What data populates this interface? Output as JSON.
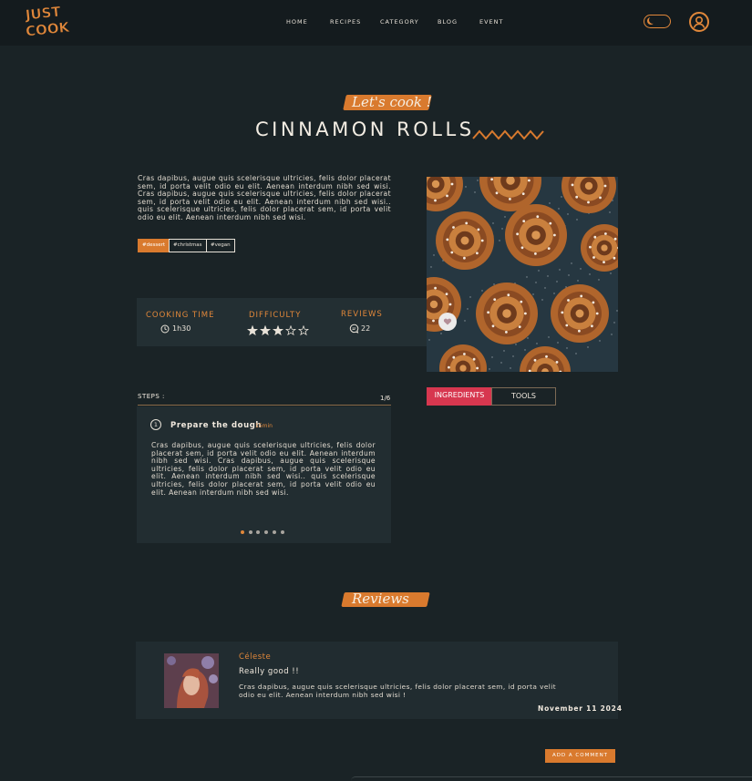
{
  "header": {
    "logo_line1": "JUST",
    "logo_line2": "COOK",
    "nav": [
      "HOME",
      "RECIPES",
      "CATEGORY",
      "BLOG",
      "EVENT"
    ]
  },
  "hero": {
    "kicker": "Let's cook !",
    "title": "CINNAMON ROLLS",
    "intro": "Cras dapibus, augue quis scelerisque ultricies, felis dolor placerat sem, id porta velit odio eu elit. Aenean interdum nibh sed wisi. Cras dapibus, augue quis scelerisque ultricies, felis dolor placerat sem, id porta velit odio eu elit. Aenean interdum nibh sed wisi.. quis scelerisque ultricies, felis dolor placerat sem, id porta velit odio eu elit. Aenean interdum nibh sed wisi.",
    "tags": [
      "#dessert",
      "#christmas",
      "#vegan"
    ]
  },
  "info": {
    "cooking_label": "COOKING TIME",
    "cooking_value": "1h30",
    "difficulty_label": "DIFFICULTY",
    "difficulty_rating": 3,
    "difficulty_max": 5,
    "reviews_label": "REVIEWS",
    "reviews_count": "22"
  },
  "steps": {
    "label": "STEPS :",
    "counter": "1/6",
    "number": "1",
    "title": "Prepare the dough",
    "duration": "15min",
    "body": "Cras dapibus, augue quis scelerisque ultricies, felis dolor placerat sem, id porta velit odio eu elit. Aenean interdum nibh sed wisi. Cras dapibus, augue quis scelerisque ultricies, felis dolor placerat sem, id porta velit odio eu elit. Aenean interdum nibh sed wisi.. quis scelerisque ultricies, felis dolor placerat sem, id porta velit odio eu elit. Aenean interdum nibh sed wisi.",
    "pages": 6,
    "current_page": 1
  },
  "tabs": {
    "ingredients": "INGREDIENTS",
    "tools": "TOOLS"
  },
  "reviews": {
    "heading": "Reviews",
    "author": "Céleste",
    "title": "Really good !!",
    "body": "Cras dapibus, augue quis scelerisque ultricies, felis dolor placerat sem, id porta velit odio eu elit. Aenean interdum nibh sed wisi !",
    "date": "November 11 2024",
    "button": "ADD A COMMENT"
  },
  "colors": {
    "accent": "#d97a2e",
    "tab_active": "#d7374f",
    "background": "#1a2326"
  }
}
